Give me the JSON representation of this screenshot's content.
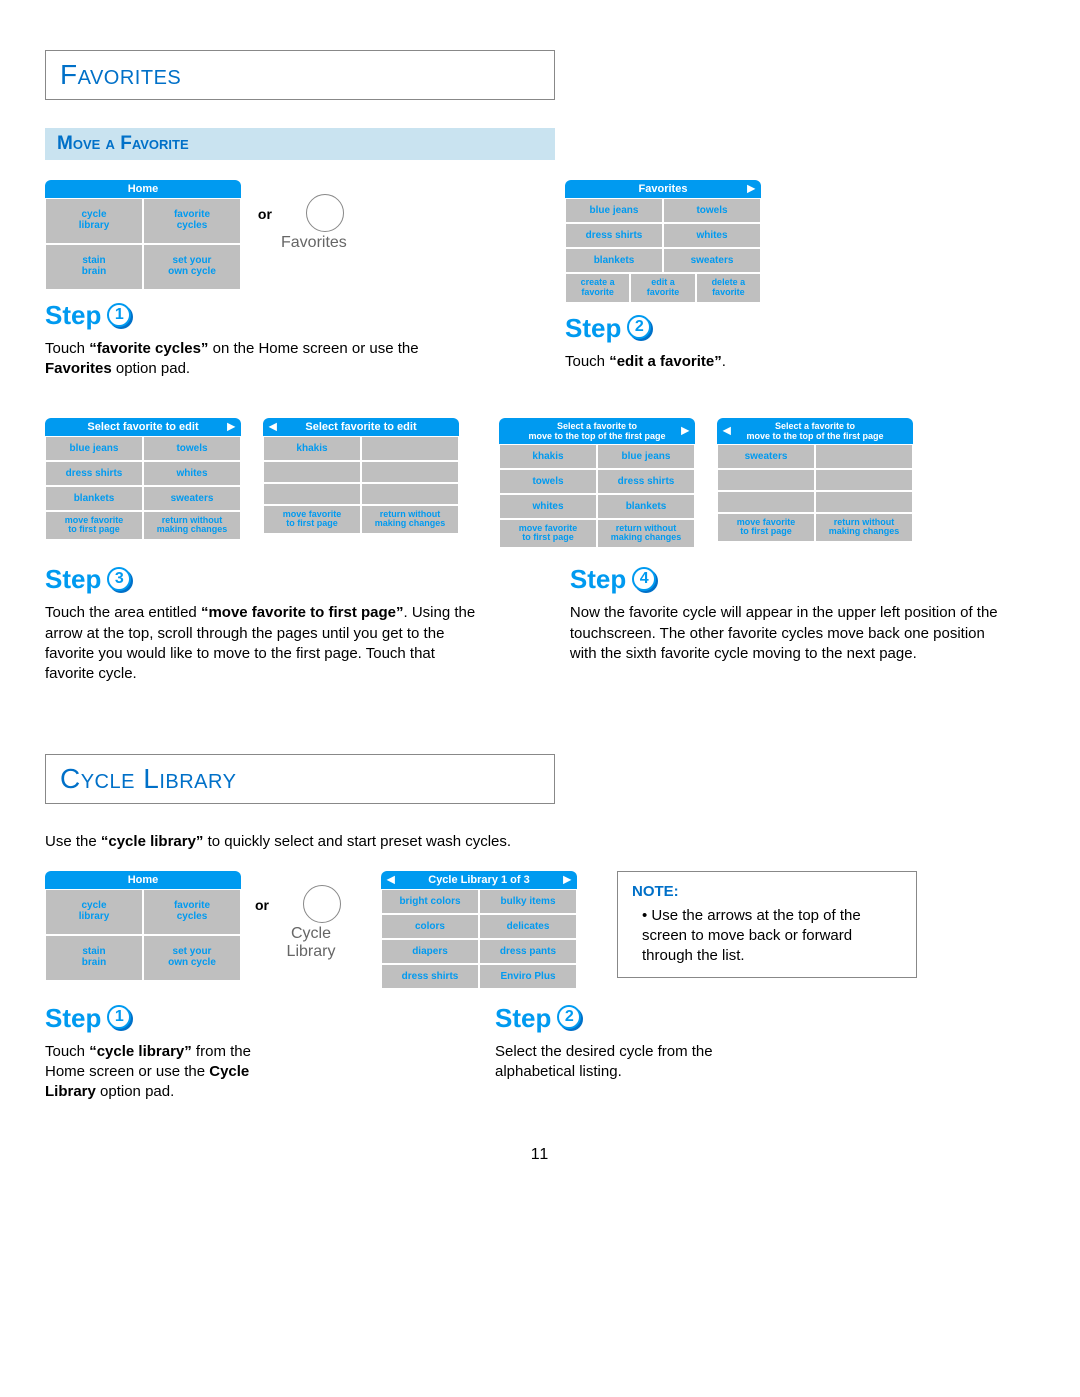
{
  "page_number": "11",
  "section_favorites": {
    "title": "Favorites",
    "sub": "Move a Favorite",
    "or": "or",
    "or_label": "Favorites",
    "home_panel": {
      "hdr": "Home",
      "cells": [
        "cycle\nlibrary",
        "favorite\ncycles",
        "stain\nbrain",
        "set your\nown cycle"
      ]
    },
    "fav_panel": {
      "hdr": "Favorites",
      "rows": [
        "blue jeans",
        "towels",
        "dress shirts",
        "whites",
        "blankets",
        "sweaters"
      ],
      "foot": [
        "create a\nfavorite",
        "edit a\nfavorite",
        "delete a\nfavorite"
      ]
    },
    "step1": {
      "n": "1",
      "desc": "Touch <b>“favorite cycles”</b> on the Home screen or use the <b>Favorites</b> option pad."
    },
    "step2": {
      "n": "2",
      "desc": "Touch <b>“edit a favorite”</b>."
    },
    "edit_hdr": "Select favorite to edit",
    "edit_rows1": [
      "blue jeans",
      "towels",
      "dress shirts",
      "whites",
      "blankets",
      "sweaters"
    ],
    "edit_rows2": [
      "khakis",
      "",
      "",
      "",
      "",
      ""
    ],
    "edit_foot": [
      "move favorite\nto first page",
      "return without\nmaking changes"
    ],
    "move_hdr": "Select a favorite to\nmove to the top of the first page",
    "move_rows1": [
      "khakis",
      "blue jeans",
      "towels",
      "dress shirts",
      "whites",
      "blankets"
    ],
    "move_rows2": [
      "sweaters",
      "",
      "",
      "",
      "",
      ""
    ],
    "step3": {
      "n": "3",
      "desc": "Touch the area entitled <b>“move favorite to first page”</b>. Using the arrow at the top, scroll through the pages until you get to the favorite you would like to move to the first page. Touch that favorite cycle."
    },
    "step4": {
      "n": "4",
      "desc": "Now the favorite cycle will appear in the upper left position of the touchscreen. The other favorite cycles move back one position with the sixth favorite cycle moving to the next page."
    }
  },
  "section_cycle": {
    "title": "Cycle Library",
    "intro": "Use the <b>“cycle library”</b> to quickly select and start preset wash cycles.",
    "or": "or",
    "or_label": "Cycle\nLibrary",
    "home_panel": {
      "hdr": "Home",
      "cells": [
        "cycle\nlibrary",
        "favorite\ncycles",
        "stain\nbrain",
        "set your\nown cycle"
      ]
    },
    "lib_panel": {
      "hdr": "Cycle Library 1 of 3",
      "rows": [
        "bright colors",
        "bulky items",
        "colors",
        "delicates",
        "diapers",
        "dress pants",
        "dress shirts",
        "Enviro Plus"
      ]
    },
    "step1": {
      "n": "1",
      "desc": "Touch <b>“cycle library”</b> from the Home screen or use the <b>Cycle Library</b> option pad."
    },
    "step2": {
      "n": "2",
      "desc": "Select the desired cycle from the alphabetical listing."
    },
    "note": {
      "hdr": "NOTE:",
      "body": "Use the arrows at the top of the screen to move back or forward through the list."
    }
  }
}
